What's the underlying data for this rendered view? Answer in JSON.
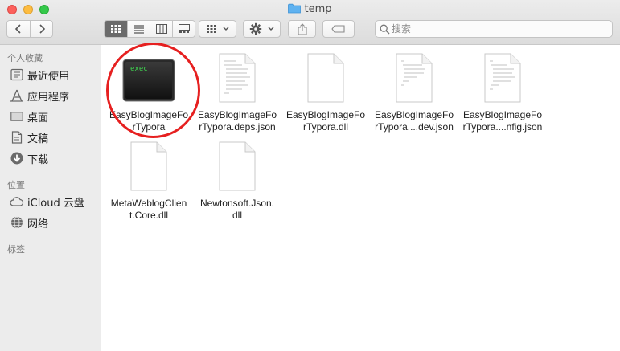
{
  "window": {
    "title": "temp"
  },
  "toolbar": {
    "back_label": "‹",
    "forward_label": "›",
    "search_placeholder": "搜索",
    "search_value": ""
  },
  "sidebar": {
    "favorites_header": "个人收藏",
    "favorites": [
      {
        "label": "最近使用",
        "icon": "clock-icon"
      },
      {
        "label": "应用程序",
        "icon": "applications-icon"
      },
      {
        "label": "桌面",
        "icon": "desktop-icon"
      },
      {
        "label": "文稿",
        "icon": "document-icon"
      },
      {
        "label": "下载",
        "icon": "download-icon"
      }
    ],
    "locations_header": "位置",
    "locations": [
      {
        "label": "iCloud 云盘",
        "icon": "cloud-icon"
      },
      {
        "label": "网络",
        "icon": "network-icon"
      }
    ],
    "tags_header": "标签"
  },
  "files": [
    {
      "line1": "EasyBlogImageFo",
      "line2": "rTypora",
      "kind": "exec"
    },
    {
      "line1": "EasyBlogImageFo",
      "line2": "rTypora.deps.json",
      "kind": "text"
    },
    {
      "line1": "EasyBlogImageFo",
      "line2": "rTypora.dll",
      "kind": "blank"
    },
    {
      "line1": "EasyBlogImageFo",
      "line2": "rTypora....dev.json",
      "kind": "text"
    },
    {
      "line1": "EasyBlogImageFo",
      "line2": "rTypora....nfig.json",
      "kind": "text"
    },
    {
      "line1": "MetaWeblogClien",
      "line2": "t.Core.dll",
      "kind": "blank"
    },
    {
      "line1": "Newtonsoft.Json.",
      "line2": "dll",
      "kind": "blank"
    }
  ],
  "exec_icon_text": "exec",
  "colors": {
    "annotation_circle": "#e62020",
    "folder": "#5fb2f0",
    "exec_text": "#3fd14f"
  }
}
